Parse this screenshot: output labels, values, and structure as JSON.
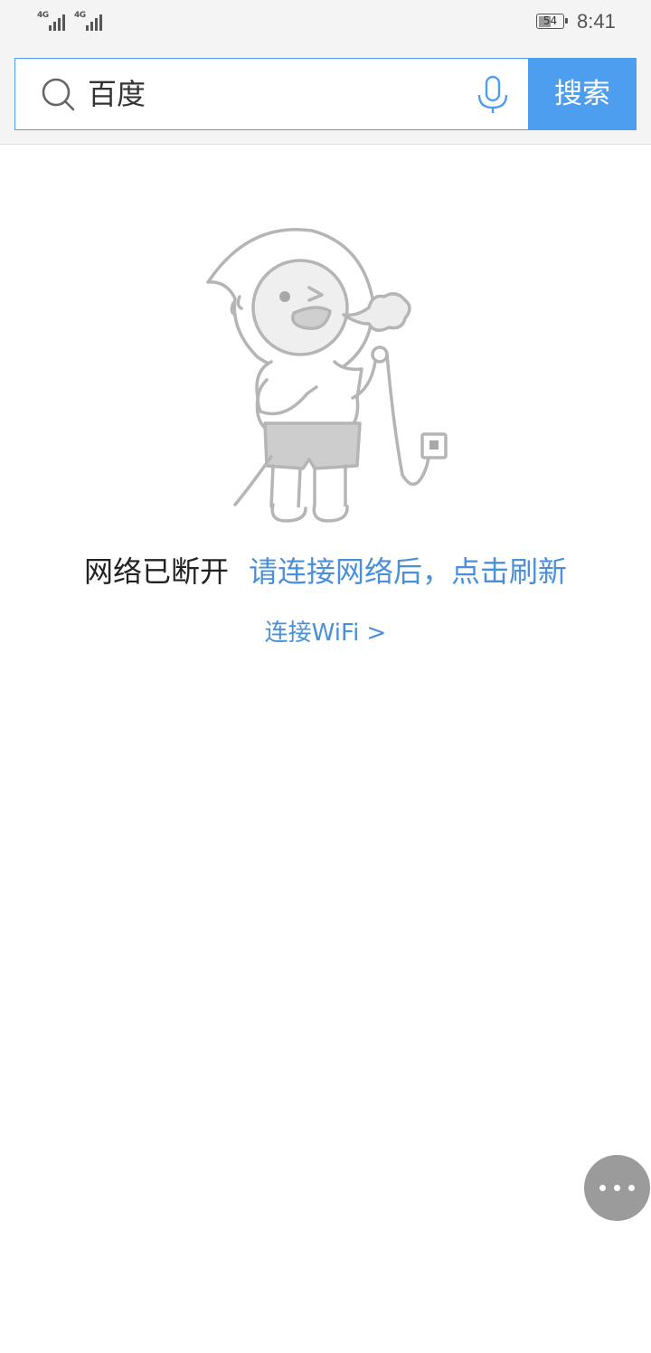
{
  "status_bar": {
    "network_1": "4G",
    "network_2": "4G",
    "battery_level": "54",
    "battery_fraction": 0.54,
    "time": "8:41"
  },
  "search": {
    "query": "百度",
    "button_label": "搜索",
    "icon": "search-icon",
    "voice_icon": "microphone-icon",
    "accent_color": "#4e9ef0"
  },
  "error": {
    "illustration": "disconnected-character-illustration",
    "title": "网络已断开",
    "hint": "请连接网络后，点击刷新",
    "wifi_link": "连接WiFi >"
  },
  "floating_menu": {
    "icon": "more-dots-icon"
  },
  "colors": {
    "header_bg": "#f4f4f4",
    "link_blue": "#4a90d8",
    "fab_gray": "#9b9b9b"
  }
}
